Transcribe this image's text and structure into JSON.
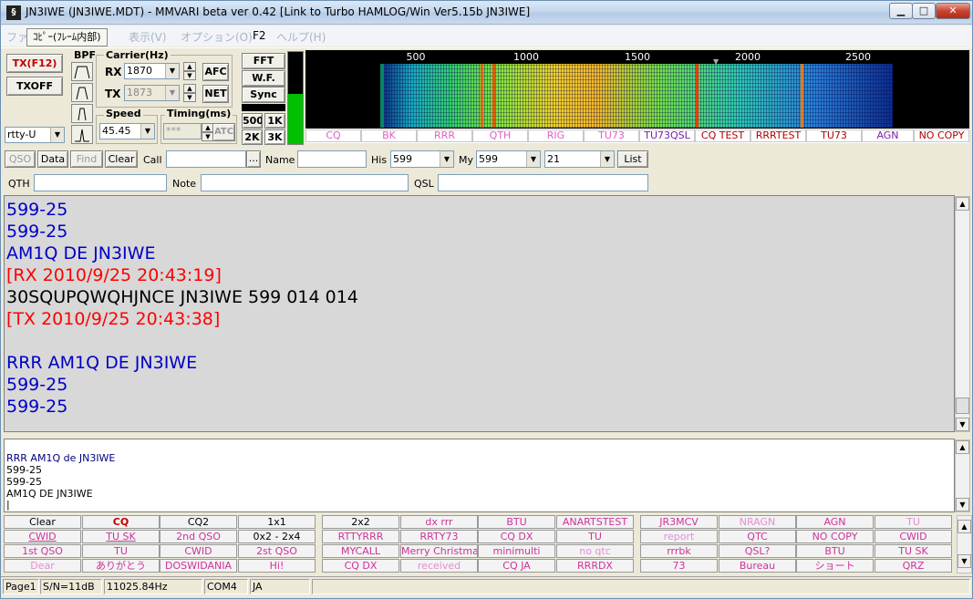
{
  "window": {
    "title": "JN3IWE (JN3IWE.MDT) - MMVARI beta ver 0.42 [Link to Turbo HAMLOG/Win Ver5.15b JN3IWE]",
    "minimize": "▁",
    "maximize": "□",
    "close": "✕"
  },
  "menu": {
    "popup": "ｺﾋﾟｰ(ﾌﾚｰﾑ内部)",
    "items_faded": [
      "ファイル(F)",
      "表示(V)",
      "オプション(O)",
      "ヘルプ(H)"
    ],
    "f2": "F2"
  },
  "controls": {
    "tx_label": "TX(F12)",
    "txoff_label": "TXOFF",
    "mode": "rtty-U",
    "bpf_label": "BPF",
    "carrier_label": "Carrier(Hz)",
    "rx_label": "RX",
    "rx_value": "1870",
    "tx_label2": "TX",
    "tx_value": "1873",
    "afc_label": "AFC",
    "net_label": "NET",
    "speed_label": "Speed",
    "speed_value": "45.45",
    "timing_label": "Timing(ms)",
    "timing_value": "***",
    "atc_label": "ATC",
    "fft_label": "FFT",
    "wf_label": "W.F.",
    "sync_label": "Sync",
    "span_500": "500",
    "span_1k": "1K",
    "span_2k": "2K",
    "span_3k": "3K"
  },
  "waterfall": {
    "freq_labels": [
      "500",
      "1000",
      "1500",
      "2000",
      "2500"
    ],
    "quick_buttons": [
      {
        "label": "CQ",
        "style": "pink"
      },
      {
        "label": "BK",
        "style": "pink"
      },
      {
        "label": "RRR",
        "style": "pink"
      },
      {
        "label": "QTH",
        "style": "pink"
      },
      {
        "label": "RIG",
        "style": "pink"
      },
      {
        "label": "TU73",
        "style": "pink"
      },
      {
        "label": "TU73QSL",
        "style": "dark"
      },
      {
        "label": "CQ TEST",
        "style": "red"
      },
      {
        "label": "RRRTEST",
        "style": "red"
      },
      {
        "label": "TU73",
        "style": "red"
      },
      {
        "label": "AGN",
        "style": "dark"
      },
      {
        "label": "NO COPY",
        "style": "red"
      }
    ]
  },
  "qso": {
    "qso_label": "QSO",
    "data_label": "Data",
    "find_label": "Find",
    "clear_label": "Clear",
    "call_label": "Call",
    "call_value": "",
    "more_label": "...",
    "name_label": "Name",
    "name_value": "",
    "his_label": "His",
    "his_value": "599",
    "my_label": "My",
    "my_value": "599",
    "time_value": "21",
    "list_label": "List",
    "qth_label": "QTH",
    "qth_value": "",
    "note_label": "Note",
    "note_value": "",
    "qsl_label": "QSL",
    "qsl_value": ""
  },
  "rx_lines": [
    {
      "text": "599-25",
      "color": "#0000c8"
    },
    {
      "text": "599-25",
      "color": "#0000c8"
    },
    {
      "text": "AM1Q DE JN3IWE",
      "color": "#0000c8"
    },
    {
      "text": "[RX 2010/9/25 20:43:19]",
      "color": "#ff0000"
    },
    {
      "text": "30SQUPQWQHJNCE JN3IWE 599 014 014",
      "color": "#000000"
    },
    {
      "text": "[TX 2010/9/25 20:43:38]",
      "color": "#ff0000"
    },
    {
      "text": "",
      "color": "#000000"
    },
    {
      "text": "RRR AM1Q DE JN3IWE",
      "color": "#0000c8"
    },
    {
      "text": "599-25",
      "color": "#0000c8"
    },
    {
      "text": "599-25",
      "color": "#0000c8"
    }
  ],
  "tx_lines": [
    {
      "text": "RRR AM1Q de JN3IWE",
      "color": "#000080"
    },
    {
      "text": "599-25",
      "color": "#000000"
    },
    {
      "text": "599-25",
      "color": "#000000"
    },
    {
      "text": "AM1Q DE JN3IWE",
      "color": "#000000"
    },
    {
      "text": "|",
      "color": "#000000"
    }
  ],
  "macros": [
    [
      {
        "label": "Clear",
        "style": "c-black"
      },
      {
        "label": "CQ",
        "style": "c-red"
      },
      {
        "label": "CQ2",
        "style": "c-black"
      },
      {
        "label": "1x1",
        "style": "c-black"
      },
      {
        "label": "2x2",
        "style": "c-black"
      },
      {
        "label": "dx rrr",
        "style": "c-pink"
      },
      {
        "label": "BTU",
        "style": "c-pink"
      },
      {
        "label": "ANARTSTEST",
        "style": "c-pink"
      },
      {
        "label": "JR3MCV",
        "style": "c-pink"
      },
      {
        "label": "NRAGN",
        "style": "c-lpink"
      },
      {
        "label": "AGN",
        "style": "c-pink"
      },
      {
        "label": "TU",
        "style": "c-lpink"
      }
    ],
    [
      {
        "label": "CWID",
        "style": "c-pink u"
      },
      {
        "label": "TU SK",
        "style": "c-pink u"
      },
      {
        "label": "2nd QSO",
        "style": "c-pink"
      },
      {
        "label": "0x2 - 2x4",
        "style": "c-black"
      },
      {
        "label": "RTTYRRR",
        "style": "c-pink"
      },
      {
        "label": "RRTY73",
        "style": "c-pink"
      },
      {
        "label": "CQ DX",
        "style": "c-pink"
      },
      {
        "label": "TU",
        "style": "c-pink"
      },
      {
        "label": "report",
        "style": "c-lpink"
      },
      {
        "label": "QTC",
        "style": "c-pink"
      },
      {
        "label": "NO COPY",
        "style": "c-pink"
      },
      {
        "label": "CWID",
        "style": "c-pink"
      }
    ],
    [
      {
        "label": "1st QSO",
        "style": "c-pink"
      },
      {
        "label": "TU",
        "style": "c-pink"
      },
      {
        "label": "CWID",
        "style": "c-pink"
      },
      {
        "label": "2st QSO",
        "style": "c-pink"
      },
      {
        "label": "MYCALL",
        "style": "c-pink"
      },
      {
        "label": "Merry Christmas",
        "style": "c-pink"
      },
      {
        "label": "minimulti",
        "style": "c-pink"
      },
      {
        "label": "no qtc",
        "style": "c-lpink"
      },
      {
        "label": "rrrbk",
        "style": "c-pink"
      },
      {
        "label": "QSL?",
        "style": "c-pink"
      },
      {
        "label": "BTU",
        "style": "c-pink"
      },
      {
        "label": "TU SK",
        "style": "c-pink"
      }
    ],
    [
      {
        "label": "Dear",
        "style": "c-lpink"
      },
      {
        "label": "ありがとう",
        "style": "c-pink"
      },
      {
        "label": "DOSWIDANIA",
        "style": "c-pink"
      },
      {
        "label": "Hi!",
        "style": "c-pink"
      },
      {
        "label": "CQ DX",
        "style": "c-pink"
      },
      {
        "label": "received",
        "style": "c-lpink"
      },
      {
        "label": "CQ JA",
        "style": "c-pink"
      },
      {
        "label": "RRRDX",
        "style": "c-pink"
      },
      {
        "label": "73",
        "style": "c-pink"
      },
      {
        "label": "Bureau",
        "style": "c-pink"
      },
      {
        "label": "ショート",
        "style": "c-pink"
      },
      {
        "label": "QRZ",
        "style": "c-pink"
      }
    ]
  ],
  "status": {
    "page": "Page1",
    "sn": "S/N=11dB",
    "clock": "11025.84Hz",
    "port": "COM4",
    "lang": "JA"
  }
}
